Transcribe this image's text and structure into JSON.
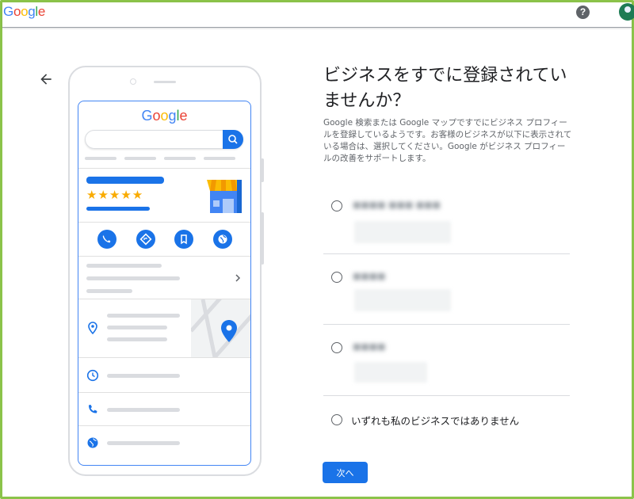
{
  "header": {
    "logo_letters": [
      {
        "ch": "G",
        "color": "#4285F4"
      },
      {
        "ch": "o",
        "color": "#EA4335"
      },
      {
        "ch": "o",
        "color": "#FBBC05"
      },
      {
        "ch": "g",
        "color": "#4285F4"
      },
      {
        "ch": "l",
        "color": "#34A853"
      },
      {
        "ch": "e",
        "color": "#EA4335"
      }
    ],
    "help_label": "?",
    "help_icon": "help-circle-icon",
    "avatar_icon": "account-avatar"
  },
  "navigation": {
    "back_icon": "arrow-left-icon"
  },
  "illustration": {
    "logo_text": "Google",
    "rating_stars": "★★★★★",
    "action_icons": [
      "phone-icon",
      "directions-icon",
      "bookmark-icon",
      "globe-icon"
    ],
    "detail_icons": [
      "location-pin-icon",
      "clock-icon",
      "phone-icon",
      "globe-icon"
    ]
  },
  "main": {
    "title": "ビジネスをすでに登録されていませんか？",
    "description": "Google 検索または Google マップですでにビジネス プロフィールを登録しているようです。お客様のビジネスが以下に表示されている場合は、選択してください。Google がビジネス プロフィールの改善をサポートします。",
    "options": [
      {
        "name_blurred": "■■■■ ■■■ ■■■",
        "address_blurred": true
      },
      {
        "name_blurred": "■■■■",
        "address_blurred": true
      },
      {
        "name_blurred": "■■■■",
        "address_blurred": true
      }
    ],
    "none_option_label": "いずれも私のビジネスではありません",
    "next_button_label": "次へ"
  },
  "colors": {
    "accent": "#1a73e8",
    "frame": "#8bc34a",
    "star": "#f9ab00"
  }
}
